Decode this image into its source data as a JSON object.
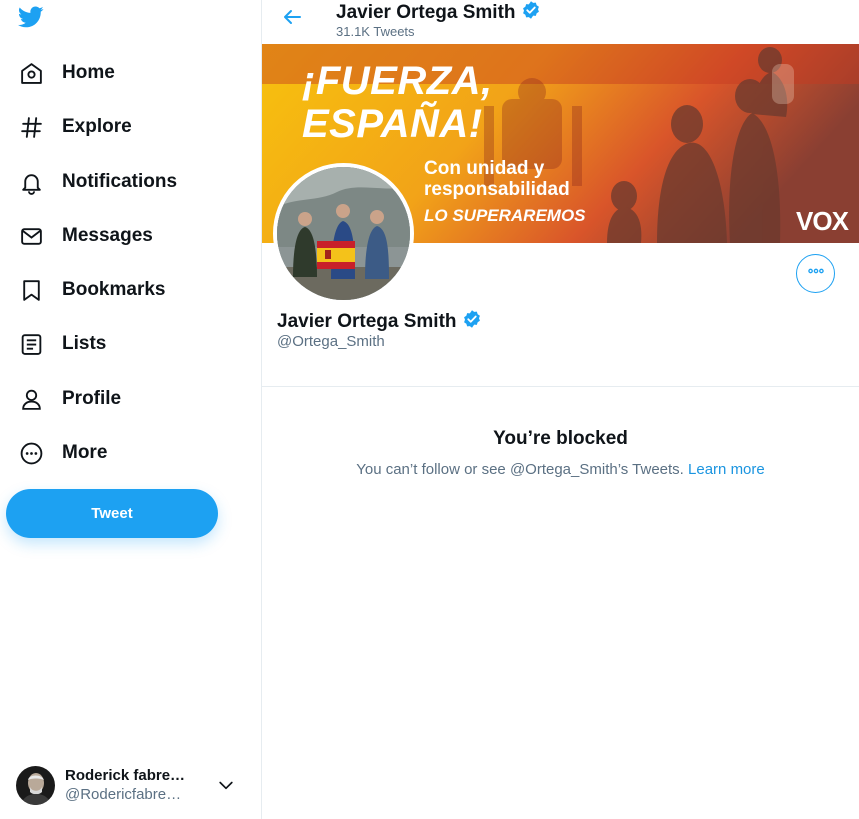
{
  "app": {
    "accent_color": "#1da1f2"
  },
  "sidebar": {
    "logo_icon": "twitter-bird-icon",
    "items": [
      {
        "label": "Home",
        "icon": "home-icon"
      },
      {
        "label": "Explore",
        "icon": "hashtag-icon"
      },
      {
        "label": "Notifications",
        "icon": "bell-icon"
      },
      {
        "label": "Messages",
        "icon": "envelope-icon"
      },
      {
        "label": "Bookmarks",
        "icon": "bookmark-icon"
      },
      {
        "label": "Lists",
        "icon": "list-icon"
      },
      {
        "label": "Profile",
        "icon": "person-icon"
      },
      {
        "label": "More",
        "icon": "more-circle-icon"
      }
    ],
    "tweet_button": "Tweet"
  },
  "account": {
    "name": "Roderick fabre…",
    "handle": "@Rodericfabre…"
  },
  "header": {
    "name": "Javier Ortega Smith",
    "tweet_count": "31.1K Tweets"
  },
  "banner": {
    "headline": "¡FUERZA, ESPAÑA!",
    "line1": "Con unidad y",
    "line2": "responsabilidad",
    "tagline": "LO SUPERAREMOS",
    "brand": "VOX"
  },
  "profile": {
    "name": "Javier Ortega Smith",
    "handle": "@Ortega_Smith",
    "verified": true
  },
  "blocked": {
    "title": "You’re blocked",
    "message": "You can’t follow or see @Ortega_Smith’s Tweets.",
    "link": "Learn more"
  }
}
